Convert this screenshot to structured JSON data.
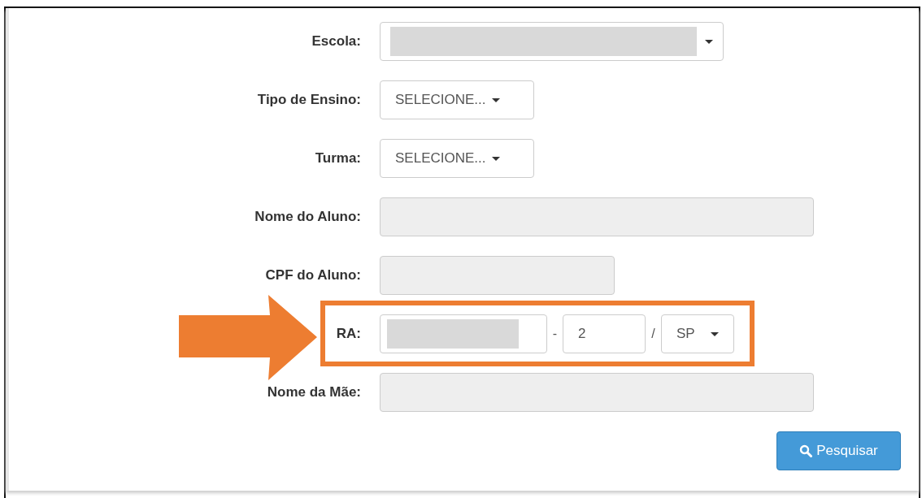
{
  "fields": [
    {
      "label": "Escola:",
      "kind": "redactedselect"
    },
    {
      "label": "Tipo de Ensino:",
      "kind": "select",
      "value": "SELECIONE..."
    },
    {
      "label": "Turma:",
      "kind": "select",
      "value": "SELECIONE..."
    },
    {
      "label": "Nome do Aluno:",
      "kind": "longdisabled"
    },
    {
      "label": "CPF do Aluno:",
      "kind": "shortdisabled"
    },
    {
      "label": "RA:",
      "kind": "ra",
      "highlighted": true,
      "separator_1": "-",
      "digit": "2",
      "separator_2": "/",
      "state": "SP"
    },
    {
      "label": "Nome da Mãe:",
      "kind": "longdisabled"
    }
  ],
  "search_button": {
    "label": "Pesquisar"
  }
}
